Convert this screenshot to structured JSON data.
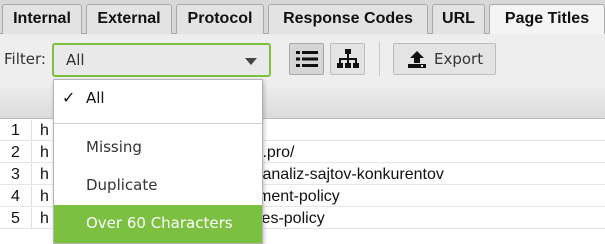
{
  "tabs": [
    {
      "label": "Internal",
      "active": false
    },
    {
      "label": "External",
      "active": false
    },
    {
      "label": "Protocol",
      "active": false
    },
    {
      "label": "Response Codes",
      "active": false
    },
    {
      "label": "URL",
      "active": false
    },
    {
      "label": "Page Titles",
      "active": true
    }
  ],
  "toolbar": {
    "filter_label": "Filter:",
    "filter_value": "All",
    "list_view_icon": "list-icon",
    "tree_view_icon": "tree-icon",
    "export_icon": "upload-icon",
    "export_label": "Export"
  },
  "dropdown": {
    "check_glyph": "✓",
    "options": [
      {
        "label": "All",
        "checked": true
      },
      {
        "label": "Missing"
      },
      {
        "label": "Duplicate"
      },
      {
        "label": "Over 60 Characters",
        "highlighted": true
      }
    ]
  },
  "table": {
    "rows": [
      {
        "num": "1",
        "visible_left": "h",
        "visible_right": ""
      },
      {
        "num": "2",
        "visible_left": "h",
        "visible_right": "r.pro/"
      },
      {
        "num": "3",
        "visible_left": "h",
        "visible_right": "/analiz-sajtov-konkurentov"
      },
      {
        "num": "4",
        "visible_left": "h",
        "visible_right": "ment-policy"
      },
      {
        "num": "5",
        "visible_left": "h",
        "visible_right": "ies-policy"
      }
    ]
  },
  "colors": {
    "accent_green": "#7cc041",
    "tab_bg": "#e3e3e3",
    "toolbar_bg": "#eeeeee"
  }
}
